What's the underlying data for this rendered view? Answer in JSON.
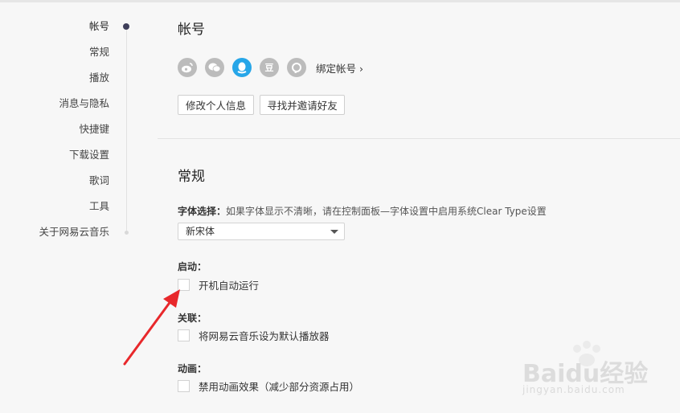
{
  "sidebar": {
    "items": [
      {
        "label": "帐号"
      },
      {
        "label": "常规"
      },
      {
        "label": "播放"
      },
      {
        "label": "消息与隐私"
      },
      {
        "label": "快捷键"
      },
      {
        "label": "下载设置"
      },
      {
        "label": "歌词"
      },
      {
        "label": "工具"
      },
      {
        "label": "关于网易云音乐"
      }
    ],
    "active_index": 0
  },
  "account": {
    "title": "帐号",
    "social_icons": [
      "weibo-icon",
      "wechat-icon",
      "qq-icon",
      "douban-icon",
      "yixin-icon"
    ],
    "douban_glyph": "豆",
    "bind_link": "绑定帐号 ›",
    "edit_profile_button": "修改个人信息",
    "find_friends_button": "寻找并邀请好友"
  },
  "general": {
    "title": "常规",
    "font_label": "字体选择：",
    "font_hint": "如果字体显示不清晰，请在控制面板—字体设置中启用系统Clear Type设置",
    "font_selected": "新宋体",
    "startup_label": "启动：",
    "startup_option": "开机自动运行",
    "startup_checked": false,
    "assoc_label": "关联：",
    "assoc_option": "将网易云音乐设为默认播放器",
    "assoc_checked": false,
    "anim_label": "动画：",
    "anim_option": "禁用动画效果（减少部分资源占用）",
    "anim_checked": false
  },
  "watermark": {
    "brand": "Baidu经验",
    "url": "jingyan.baidu.com"
  },
  "colors": {
    "qq_accent": "#27a6e8",
    "annotation_arrow": "#e8282b",
    "active_dot": "#3f3f5a"
  }
}
